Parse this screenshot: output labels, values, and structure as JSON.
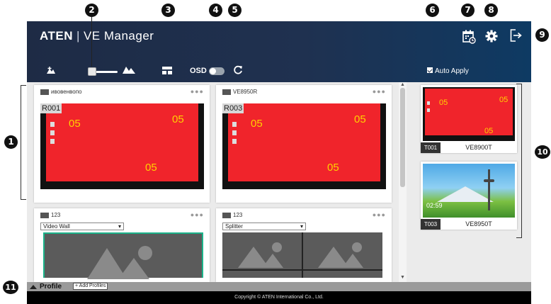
{
  "header": {
    "brand": "ATEN",
    "separator": "|",
    "app_title": "VE Manager",
    "osd_label": "OSD",
    "auto_apply_label": "Auto Apply",
    "auto_apply_checked": true,
    "osd_enabled": false,
    "icons": [
      "zoom-out-icon",
      "zoom-in-icon",
      "layout-icon",
      "refresh-icon",
      "schedule-icon",
      "gear-icon",
      "logout-icon"
    ]
  },
  "callouts": [
    "1",
    "2",
    "3",
    "4",
    "5",
    "6",
    "7",
    "8",
    "9",
    "10",
    "11"
  ],
  "receivers": [
    {
      "name": "ивовенвопо",
      "id": "R001",
      "nums": [
        "05",
        "05",
        "05"
      ]
    },
    {
      "name": "VE8950R",
      "id": "R003",
      "nums": [
        "05",
        "05",
        "05"
      ]
    }
  ],
  "groups": [
    {
      "name": "123",
      "mode": "Video Wall"
    },
    {
      "name": "123",
      "mode": "Splitter"
    }
  ],
  "transmitters": [
    {
      "id": "T001",
      "name": "VE8900T",
      "nums": [
        "05",
        "05",
        "05"
      ]
    },
    {
      "id": "T003",
      "name": "VE8950T",
      "time": "02:59"
    }
  ],
  "profile": {
    "label": "Profile",
    "add_label": "+ Add Profiles"
  },
  "footer": {
    "copyright": "Copyright © ATEN International Co., Ltd."
  },
  "colors": {
    "header": "#1e2b45",
    "screen_red": "#f0242b",
    "accent_number": "#ffd200",
    "wall_border": "#1bb38a"
  }
}
